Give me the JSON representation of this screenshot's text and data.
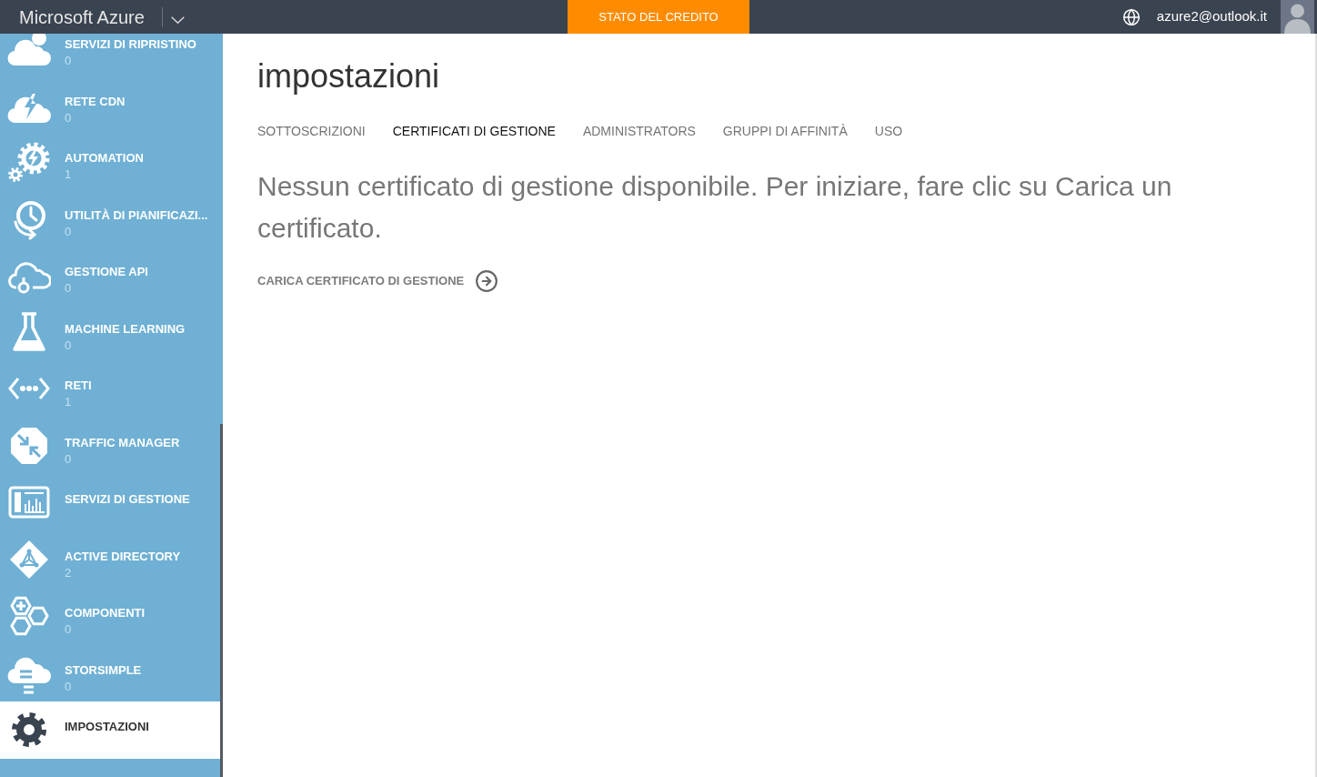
{
  "top_bar": {
    "brand": "Microsoft Azure",
    "credit_button": "STATO DEL CREDITO",
    "account": "azure2@outlook.it"
  },
  "sidebar": {
    "items": [
      {
        "label": "SERVIZI DI RIPRISTINO",
        "count": "0",
        "selected": false
      },
      {
        "label": "RETE CDN",
        "count": "0",
        "selected": false
      },
      {
        "label": "AUTOMATION",
        "count": "1",
        "selected": false
      },
      {
        "label": "UTILITÀ DI PIANIFICAZI...",
        "count": "0",
        "selected": false
      },
      {
        "label": "GESTIONE API",
        "count": "0",
        "selected": false
      },
      {
        "label": "MACHINE LEARNING",
        "count": "0",
        "selected": false
      },
      {
        "label": "RETI",
        "count": "1",
        "selected": false
      },
      {
        "label": "TRAFFIC MANAGER",
        "count": "0",
        "selected": false
      },
      {
        "label": "SERVIZI DI GESTIONE",
        "selected": false
      },
      {
        "label": "ACTIVE DIRECTORY",
        "count": "2",
        "selected": false
      },
      {
        "label": "COMPONENTI",
        "count": "0",
        "selected": false
      },
      {
        "label": "STORSIMPLE",
        "count": "0",
        "selected": false
      },
      {
        "label": "IMPOSTAZIONI",
        "selected": true
      }
    ]
  },
  "main": {
    "title": "impostazioni",
    "tabs": [
      {
        "label": "SOTTOSCRIZIONI",
        "selected": false
      },
      {
        "label": "CERTIFICATI DI GESTIONE",
        "selected": true
      },
      {
        "label": "ADMINISTRATORS",
        "selected": false
      },
      {
        "label": "GRUPPI DI AFFINITÀ",
        "selected": false
      },
      {
        "label": "USO",
        "selected": false
      }
    ],
    "message": "Nessun certificato di gestione disponibile. Per iniziare, fare clic su Carica un certificato.",
    "action": "CARICA CERTIFICATO DI GESTIONE"
  }
}
